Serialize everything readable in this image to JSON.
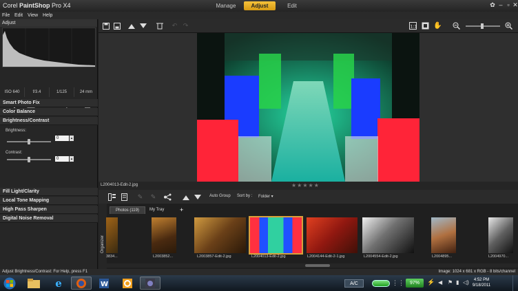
{
  "app": {
    "title_prefix": "Corel ",
    "title_bold": "PaintShop",
    "title_suffix": " Pro X4"
  },
  "modes": [
    {
      "label": "Manage"
    },
    {
      "label": "Adjust"
    },
    {
      "label": "Edit"
    }
  ],
  "menu": [
    {
      "label": "File"
    },
    {
      "label": "Edit"
    },
    {
      "label": "View"
    },
    {
      "label": "Help"
    }
  ],
  "left_panel": {
    "title": "Adjust",
    "exif": [
      "ISO 640",
      "f/3.4",
      "1/125",
      "24 mm"
    ],
    "sections_top": [
      "Smart Photo Fix",
      "Color Balance",
      "Brightness/Contrast"
    ],
    "brightness": {
      "label": "Brightness:",
      "value": "0",
      "level": 0.5
    },
    "contrast": {
      "label": "Contrast:",
      "value": "0",
      "level": 0.5
    },
    "sections_bottom": [
      "Fill Light/Clarity",
      "Local Tone Mapping",
      "High Pass Sharpen",
      "Digital Noise Removal"
    ]
  },
  "preview": {
    "filename": "L2004013-Edit-2.jpg",
    "stars": "★★★★★",
    "rating": 0
  },
  "organizer": {
    "side_label": "Organizer",
    "auto_group": "Auto Group",
    "sort_by": "Sort by :",
    "sort_value": "Folder ▾",
    "tabs": [
      {
        "label": "Photos (119)"
      },
      {
        "label": "My Tray"
      }
    ],
    "add_tab": "+",
    "thumbnails": [
      {
        "caption": "3834..."
      },
      {
        "caption": "L2003852..."
      },
      {
        "caption": "L2003857-Edit-2.jpg"
      },
      {
        "caption": "L2004013-Edit-2.jpg"
      },
      {
        "caption": "L2004144-Edit-2-1.jpg"
      },
      {
        "caption": "L2004554-Edit-2.jpg"
      },
      {
        "caption": "L2004895..."
      },
      {
        "caption": "L2004970..."
      }
    ]
  },
  "status": {
    "left": "Adjust Brightness/Contrast: For Help, press F1",
    "right": "Image: 1024 x 681 x RGB - 8 bits/channel"
  },
  "taskbar": {
    "ac_label": "A/C",
    "battery": "97%",
    "time": "4:52 PM",
    "date": "9/18/2011"
  }
}
